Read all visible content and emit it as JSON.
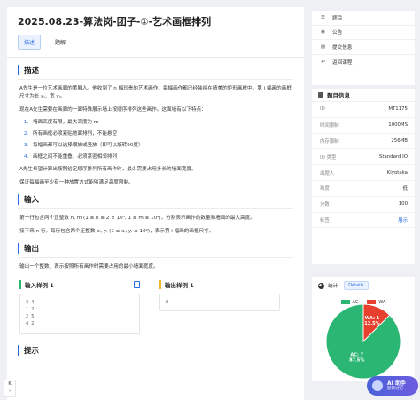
{
  "problem": {
    "title": "2025.08.23-算法岗-团子-①-艺术画框排列",
    "tabs": [
      {
        "label": "描述",
        "active": true
      },
      {
        "label": "题解",
        "active": false
      }
    ]
  },
  "description": {
    "heading": "描述",
    "p1": "A先生是一位艺术画廊的策展人。他收到了 n 幅珍贵的艺术画作，每幅画作都已经装裱在精美的矩形画框中。第 i 幅画的画框尺寸为长 xᵢ，宽 yᵢ。",
    "p2": "现在A先生需要在画廊的一面特殊展示墙上按顺序排列这些画作。这面墙有以下特点：",
    "rules": [
      "墙面高度有限，最大高度为 m",
      "所有画框必须紧贴地面排列，不能悬空",
      "每幅画都可以选择横放或竖放（即可以旋转90度）",
      "画框之间不能重叠，必须紧密相邻排列"
    ],
    "p3": "A先生希望计算出按照给定顺序排列所有画作时，最少需要占用多长的墙面宽度。",
    "p4": "保证每幅画至少有一种放置方式能够满足高度限制。"
  },
  "input": {
    "heading": "输入",
    "p1": "第一行包含两个正整数 n, m (1 ≤ n ≤ 2 × 10⁵, 1 ≤ m ≤ 10⁹)，分别表示画作的数量和墙面的最大高度。",
    "p2": "接下来 n 行，每行包含两个正整数 xᵢ, yᵢ (1 ≤ xᵢ, yᵢ ≤ 10⁹)，表示第 i 幅画的画框尺寸。"
  },
  "output": {
    "heading": "输出",
    "p1": "输出一个整数，表示按照所有画作时需要占用的最小墙面宽度。"
  },
  "samples": {
    "input_label": "输入样例 1",
    "output_label": "输出样例 1",
    "input_lines": [
      "3 4",
      "1 2",
      "2 5",
      "4 2"
    ],
    "output_lines": [
      "8"
    ]
  },
  "next_heading": "提示",
  "sidebar_nav": [
    {
      "label": "题目",
      "icon": "list-icon"
    },
    {
      "label": "公告",
      "icon": "bell-icon"
    },
    {
      "label": "提交信息",
      "icon": "document-icon"
    },
    {
      "label": "返回课程",
      "icon": "back-arrow-icon"
    }
  ],
  "problem_info": {
    "heading": "题目信息",
    "rows": [
      {
        "k": "ID",
        "v": "MT1175"
      },
      {
        "k": "时间限制",
        "v": "1000MS"
      },
      {
        "k": "内存限制",
        "v": "256MB"
      },
      {
        "k": "IO 类型",
        "v": "Standard IO"
      },
      {
        "k": "出题人",
        "v": "Kiyotaka"
      },
      {
        "k": "难度",
        "v": "低"
      },
      {
        "k": "分数",
        "v": "100"
      },
      {
        "k": "标签",
        "v": "展示"
      }
    ]
  },
  "stats": {
    "heading": "统计",
    "details_label": "Details"
  },
  "chart_data": {
    "type": "pie",
    "series": [
      {
        "name": "AC",
        "value": 7,
        "percent": 87.5,
        "color": "#2bb673"
      },
      {
        "name": "WA",
        "value": 1,
        "percent": 12.5,
        "color": "#e8402e"
      }
    ],
    "labels": [
      "AC: 7\n87.5%",
      "WA: 1\n12.5%"
    ],
    "legend_position": "top"
  },
  "ai_assistant": {
    "title": "AI 助手",
    "subtitle": "题目讨论"
  },
  "keyboard_hint": "K"
}
